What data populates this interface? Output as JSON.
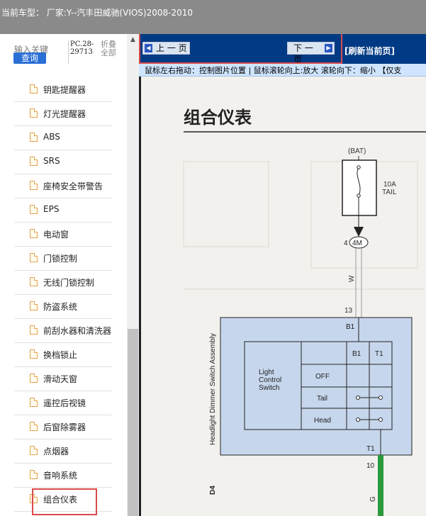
{
  "header": {
    "title": "当前车型： 厂家:Y--汽丰田威驰(VIOS)2008-2010"
  },
  "search": {
    "label": "输入关键",
    "button": "查询"
  },
  "pc_code": "PC.28-29713",
  "collapse_all": "折叠全部",
  "tree_items": [
    "钥匙提醒器",
    "灯光提醒器",
    "ABS",
    "SRS",
    "座椅安全带警告",
    "EPS",
    "电动窗",
    "门锁控制",
    "无线门锁控制",
    "防盗系统",
    "前刮水器和清洗器",
    "换档锁止",
    "滑动天窗",
    "遥控后视镜",
    "后窗除雾器",
    "点烟器",
    "音响系统",
    "组合仪表"
  ],
  "nav": {
    "prev": "上 一 页",
    "next": "下 一 页",
    "refresh": "[刷新当前页]"
  },
  "hint": "鼠标左右拖动：控制图片位置 | 鼠标滚轮向上:放大  滚轮向下：缩小 【仅支",
  "diagram": {
    "title": "组合仪表",
    "bat": "(BAT)",
    "fuse_amp": "10A",
    "fuse_name": "TAIL",
    "pin4": "4",
    "connector": "4M",
    "wire_w": "W",
    "pin13": "13",
    "b1_top": "B1",
    "col_b1": "B1",
    "col_t1": "T1",
    "switch_label_1": "Light",
    "switch_label_2": "Control",
    "switch_label_3": "Switch",
    "row_off": "OFF",
    "row_tail": "Tail",
    "row_head": "Head",
    "t1_bottom": "T1",
    "pin10": "10",
    "wire_g": "G",
    "side_label": "Headlight Dimmer Switch Assembly",
    "d4": "D4"
  }
}
